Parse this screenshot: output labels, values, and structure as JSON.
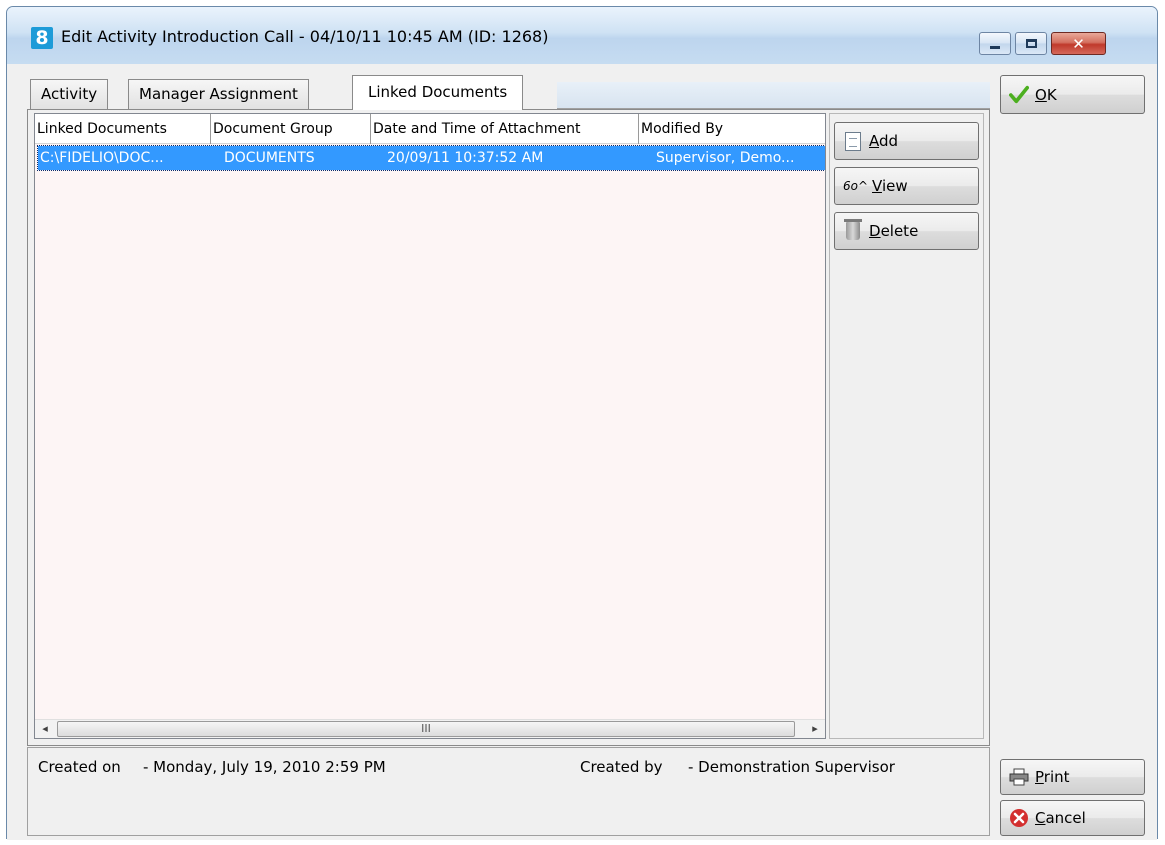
{
  "window": {
    "title": "Edit Activity Introduction Call - 04/10/11 10:45 AM (ID: 1268)",
    "app_icon_glyph": "8",
    "close_glyph": "✕"
  },
  "tabs": [
    {
      "label": "Activity"
    },
    {
      "label": "Manager Assignment"
    },
    {
      "label": "Linked Documents",
      "active": true
    }
  ],
  "list": {
    "columns": [
      "Linked Documents",
      "Document Group",
      "Date and Time of Attachment",
      "Modified By"
    ],
    "rows": [
      {
        "linked_document": "C:\\FIDELIO\\DOC...",
        "document_group": "DOCUMENTS",
        "date_time": "20/09/11 10:37:52 AM",
        "modified_by": "Supervisor, Demo...",
        "selected": true
      }
    ],
    "scroll_left_glyph": "◂",
    "scroll_right_glyph": "▸",
    "scroll_thumb_glyph": "III"
  },
  "side_buttons": {
    "add": {
      "accel": "A",
      "rest": "dd",
      "icon": "document-icon"
    },
    "view": {
      "accel": "V",
      "rest": "iew",
      "icon": "glasses-icon",
      "glyph": "6o^"
    },
    "delete": {
      "accel": "D",
      "rest": "elete",
      "icon": "trash-icon"
    }
  },
  "dialog_buttons": {
    "ok": {
      "accel": "O",
      "rest": "K",
      "icon": "checkmark-icon"
    },
    "print": {
      "accel": "P",
      "rest": "rint",
      "icon": "printer-icon"
    },
    "cancel": {
      "accel": "C",
      "rest": "ancel",
      "icon": "cancel-icon"
    }
  },
  "footer": {
    "created_on_label": "Created on",
    "created_on_value": "- Monday, July 19, 2010 2:59 PM",
    "created_by_label": "Created by",
    "created_by_value": "- Demonstration Supervisor"
  },
  "colors": {
    "selection": "#3399ff",
    "list_background": "#fdf5f5",
    "ok_check": "#4caf1f",
    "cancel_red": "#d32f2f"
  }
}
